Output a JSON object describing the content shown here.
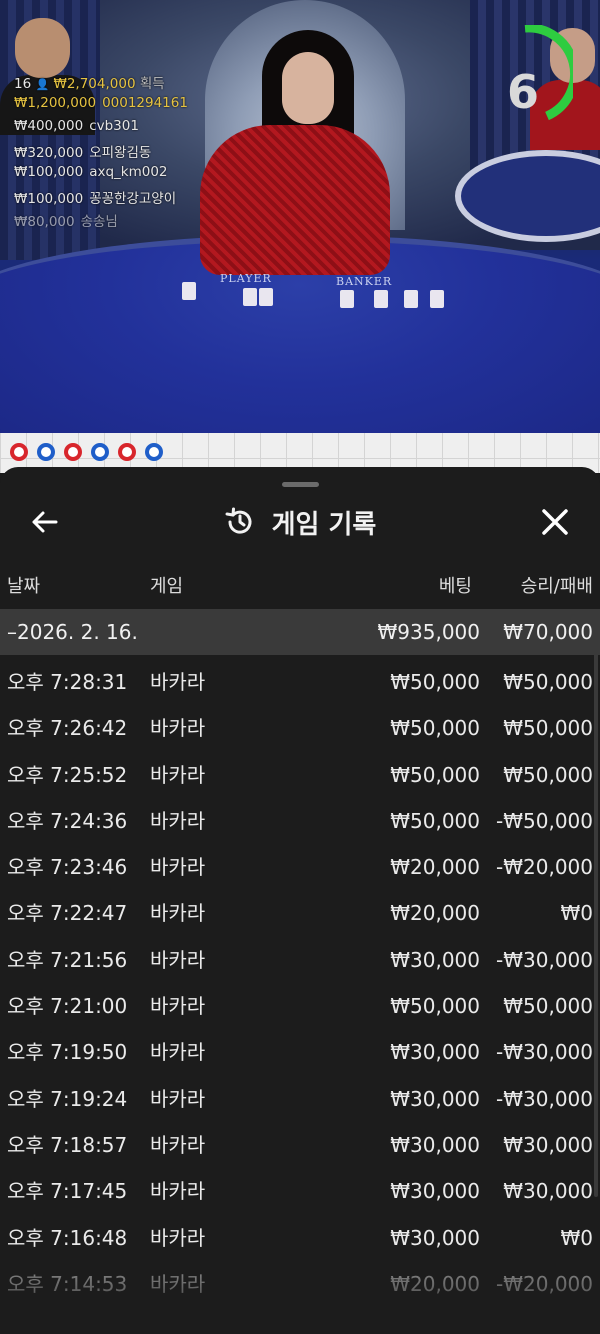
{
  "video": {
    "timer": "6",
    "timer_color": "#2ecc40",
    "table_labels": {
      "player": "PLAYER",
      "banker": "BANKER"
    },
    "bet_summary": {
      "count": "16",
      "total": "₩2,704,000",
      "suffix": "획득"
    },
    "bets": [
      {
        "amount": "₩1,200,000",
        "name": "0001294161"
      },
      {
        "amount": "₩400,000",
        "name": "cvb301"
      },
      {
        "amount": "₩320,000",
        "name": "오피왕김동"
      },
      {
        "amount": "₩100,000",
        "name": "axq_km002"
      },
      {
        "amount": "₩100,000",
        "name": "꽁꽁한강고양이"
      },
      {
        "amount": "₩80,000",
        "name": "송송님"
      }
    ]
  },
  "road": {
    "dots": [
      "#d8262c",
      "#1f5ec9",
      "#d8262c",
      "#1f5ec9",
      "#d8262c",
      "#1f5ec9"
    ]
  },
  "sheet": {
    "title": "게임 기록",
    "back_icon": "arrow-left-icon",
    "history_icon": "history-icon",
    "close_icon": "close-icon",
    "columns": {
      "date": "날짜",
      "game": "게임",
      "bet": "베팅",
      "result": "승리/패배"
    },
    "day": {
      "date": "–2026. 2. 16.",
      "bet": "₩935,000",
      "result": "₩70,000"
    },
    "rows": [
      {
        "time": "오후 7:28:31",
        "game": "바카라",
        "bet": "₩50,000",
        "result": "₩50,000"
      },
      {
        "time": "오후 7:26:42",
        "game": "바카라",
        "bet": "₩50,000",
        "result": "₩50,000"
      },
      {
        "time": "오후 7:25:52",
        "game": "바카라",
        "bet": "₩50,000",
        "result": "₩50,000"
      },
      {
        "time": "오후 7:24:36",
        "game": "바카라",
        "bet": "₩50,000",
        "result": "-₩50,000"
      },
      {
        "time": "오후 7:23:46",
        "game": "바카라",
        "bet": "₩20,000",
        "result": "-₩20,000"
      },
      {
        "time": "오후 7:22:47",
        "game": "바카라",
        "bet": "₩20,000",
        "result": "₩0"
      },
      {
        "time": "오후 7:21:56",
        "game": "바카라",
        "bet": "₩30,000",
        "result": "-₩30,000"
      },
      {
        "time": "오후 7:21:00",
        "game": "바카라",
        "bet": "₩50,000",
        "result": "₩50,000"
      },
      {
        "time": "오후 7:19:50",
        "game": "바카라",
        "bet": "₩30,000",
        "result": "-₩30,000"
      },
      {
        "time": "오후 7:19:24",
        "game": "바카라",
        "bet": "₩30,000",
        "result": "-₩30,000"
      },
      {
        "time": "오후 7:18:57",
        "game": "바카라",
        "bet": "₩30,000",
        "result": "₩30,000"
      },
      {
        "time": "오후 7:17:45",
        "game": "바카라",
        "bet": "₩30,000",
        "result": "₩30,000"
      },
      {
        "time": "오후 7:16:48",
        "game": "바카라",
        "bet": "₩30,000",
        "result": "₩0"
      },
      {
        "time": "오후 7:14:53",
        "game": "바카라",
        "bet": "₩20,000",
        "result": "-₩20,000"
      }
    ]
  }
}
